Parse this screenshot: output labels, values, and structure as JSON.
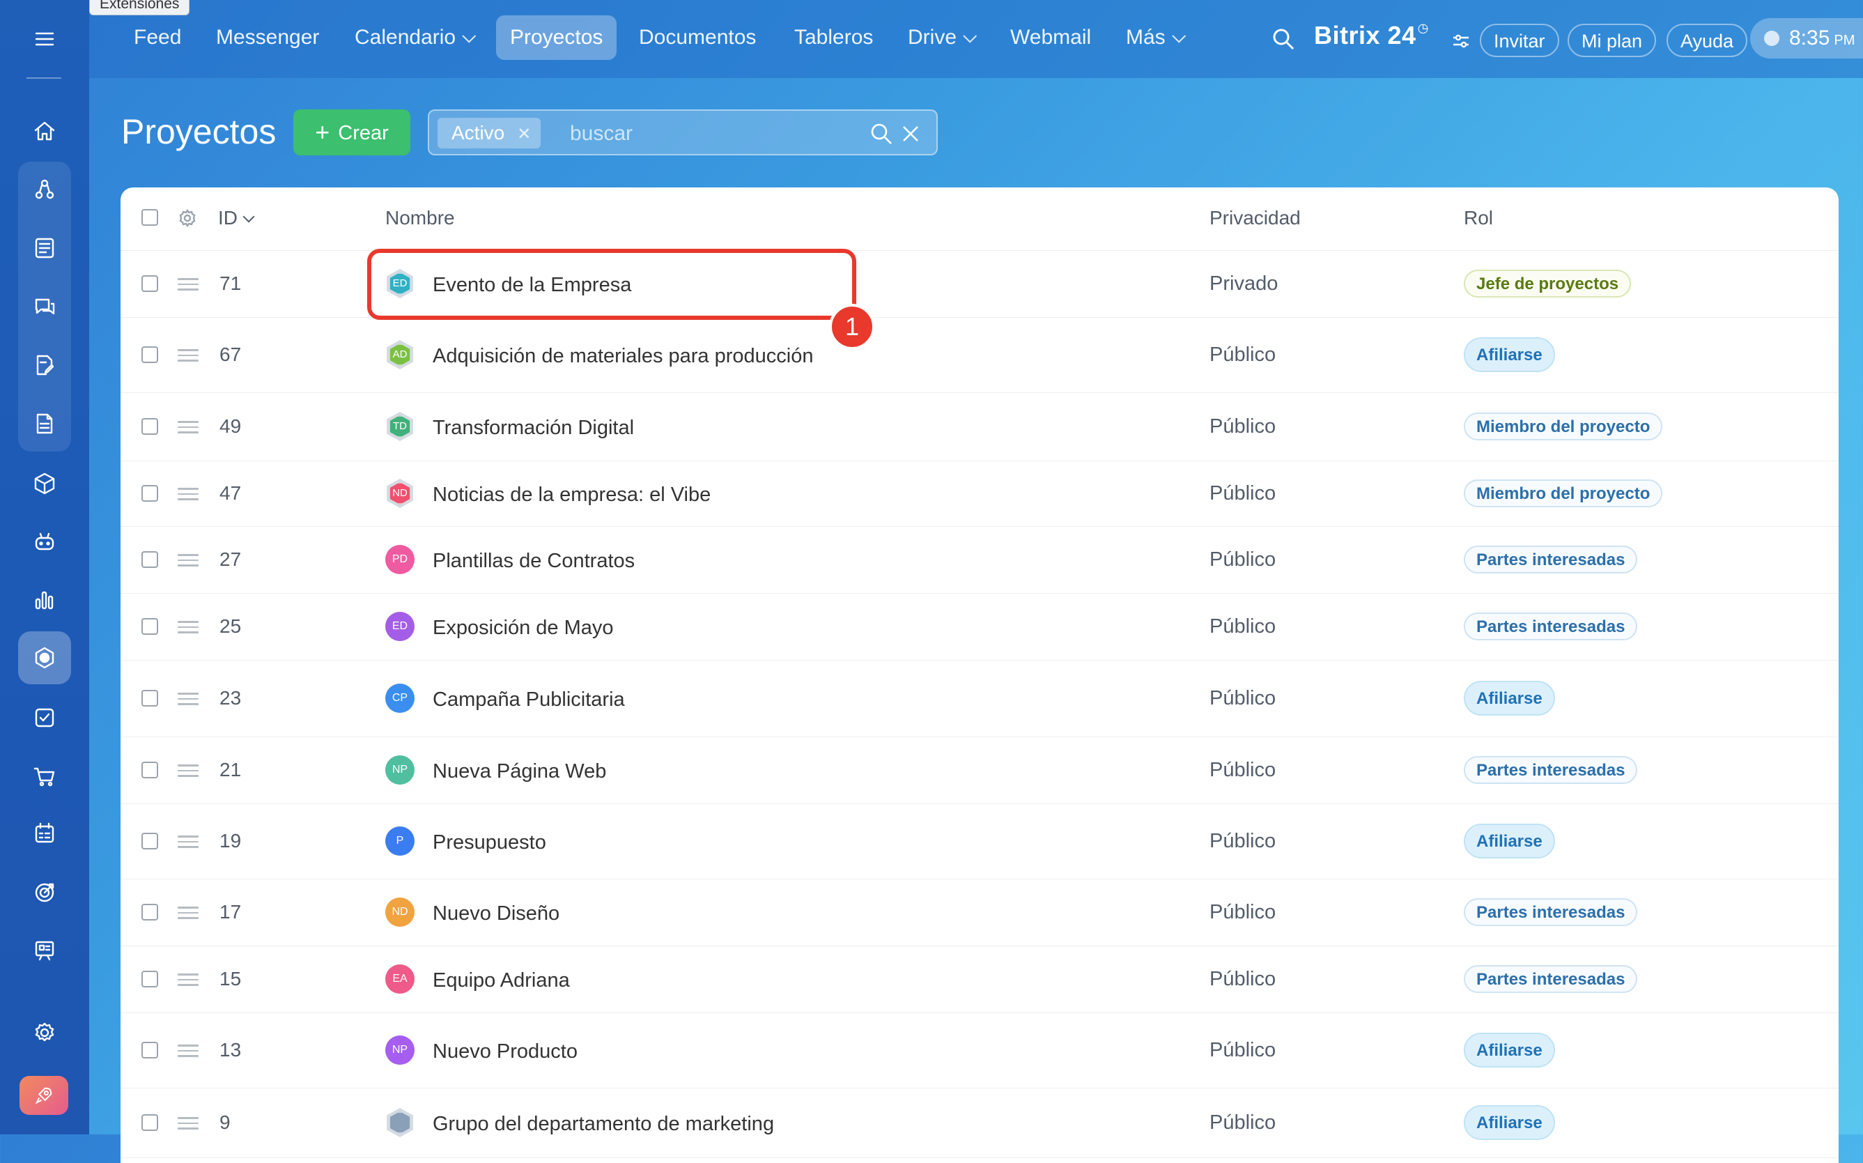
{
  "tooltip": "Extensiones",
  "nav": {
    "items": [
      {
        "label": "Feed"
      },
      {
        "label": "Messenger"
      },
      {
        "label": "Calendario"
      },
      {
        "label": "Proyectos"
      },
      {
        "label": "Documentos"
      },
      {
        "label": "Tableros"
      },
      {
        "label": "Drive"
      },
      {
        "label": "Webmail"
      },
      {
        "label": "Más"
      }
    ],
    "brand": "Bitrix 24",
    "invite": "Invitar",
    "plan": "Mi plan",
    "help": "Ayuda",
    "time": "8:35",
    "ampm": "PM"
  },
  "sidebar": {
    "icons": [
      "menu-icon",
      "home-icon",
      "workflow-icon",
      "news-icon",
      "chat-icon",
      "edit-doc-icon",
      "document-icon",
      "box-icon",
      "robot-icon",
      "analytics-icon",
      "projects-icon",
      "tasks-icon",
      "cart-icon",
      "schedule-icon",
      "target-icon",
      "presentation-icon",
      "settings-icon",
      "rocket-icon"
    ]
  },
  "page": {
    "title": "Proyectos",
    "create_label": "Crear",
    "filter_chip": "Activo",
    "search_placeholder": "buscar"
  },
  "table": {
    "headers": {
      "id": "ID",
      "name": "Nombre",
      "privacy": "Privacidad",
      "role": "Rol"
    },
    "rows": [
      {
        "id": "71",
        "initials": "ED",
        "name": "Evento de la Empresa",
        "privacy": "Privado",
        "role": "Jefe de proyectos",
        "role_type": "owner",
        "avatar_color": "#2fb0c5",
        "hex": true
      },
      {
        "id": "67",
        "initials": "AD",
        "name": "Adquisición de materiales para producción",
        "privacy": "Público",
        "role": "Afiliarse",
        "role_type": "join",
        "avatar_color": "#7bc043",
        "hex": true
      },
      {
        "id": "49",
        "initials": "TD",
        "name": "Transformación Digital",
        "privacy": "Público",
        "role": "Miembro del proyecto",
        "role_type": "member",
        "avatar_color": "#41b07a",
        "hex": true
      },
      {
        "id": "47",
        "initials": "ND",
        "name": "Noticias de la empresa: el Vibe",
        "privacy": "Público",
        "role": "Miembro del proyecto",
        "role_type": "member",
        "avatar_color": "#f0506e",
        "hex": true
      },
      {
        "id": "27",
        "initials": "PD",
        "name": "Plantillas de Contratos",
        "privacy": "Público",
        "role": "Partes interesadas",
        "role_type": "member",
        "avatar_color": "#ef5ba1",
        "hex": false
      },
      {
        "id": "25",
        "initials": "ED",
        "name": "Exposición de Mayo",
        "privacy": "Público",
        "role": "Partes interesadas",
        "role_type": "member",
        "avatar_color": "#a45de6",
        "hex": false
      },
      {
        "id": "23",
        "initials": "CP",
        "name": "Campaña Publicitaria",
        "privacy": "Público",
        "role": "Afiliarse",
        "role_type": "join",
        "avatar_color": "#3a8ef0",
        "hex": false
      },
      {
        "id": "21",
        "initials": "NP",
        "name": "Nueva Página Web",
        "privacy": "Público",
        "role": "Partes interesadas",
        "role_type": "member",
        "avatar_color": "#4fbfa0",
        "hex": false
      },
      {
        "id": "19",
        "initials": "P",
        "name": "Presupuesto",
        "privacy": "Público",
        "role": "Afiliarse",
        "role_type": "join",
        "avatar_color": "#3a7df0",
        "hex": false
      },
      {
        "id": "17",
        "initials": "ND",
        "name": "Nuevo Diseño",
        "privacy": "Público",
        "role": "Partes interesadas",
        "role_type": "member",
        "avatar_color": "#f1a340",
        "hex": false
      },
      {
        "id": "15",
        "initials": "EA",
        "name": "Equipo Adriana",
        "privacy": "Público",
        "role": "Partes interesadas",
        "role_type": "member",
        "avatar_color": "#ee5a8a",
        "hex": false
      },
      {
        "id": "13",
        "initials": "NP",
        "name": "Nuevo Producto",
        "privacy": "Público",
        "role": "Afiliarse",
        "role_type": "join",
        "avatar_color": "#a55ef0",
        "hex": false
      },
      {
        "id": "9",
        "initials": "",
        "name": "Grupo del departamento de marketing",
        "privacy": "Público",
        "role": "Afiliarse",
        "role_type": "join",
        "avatar_color": "#8aa0b8",
        "hex": true
      }
    ]
  },
  "annotation": {
    "badge": "1"
  },
  "colors": {
    "accent_green": "#3cbf6e",
    "highlight_red": "#e8392c"
  }
}
